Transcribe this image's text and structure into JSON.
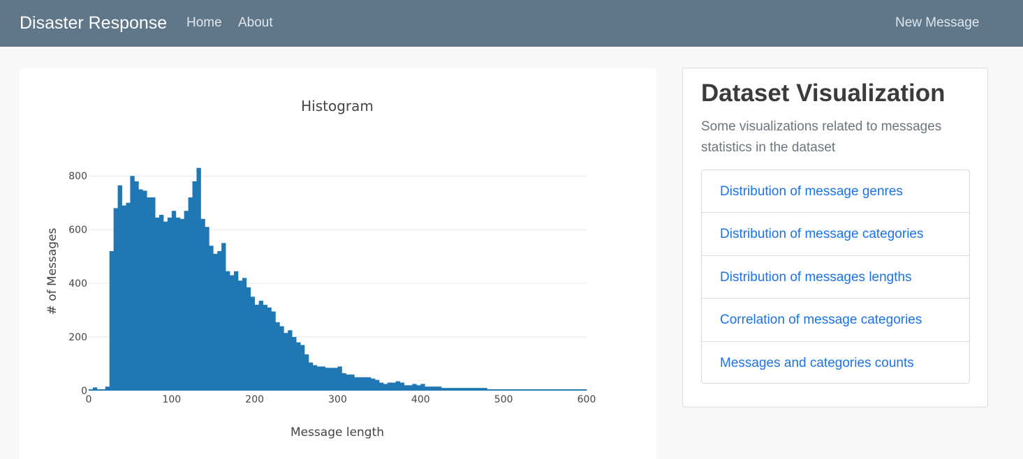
{
  "navbar": {
    "brand": "Disaster Response",
    "links": [
      "Home",
      "About"
    ],
    "right_link": "New Message"
  },
  "card": {
    "title": "Dataset Visualization",
    "subtitle": "Some visualizations related to messages statistics in the dataset",
    "items": [
      "Distribution of message genres",
      "Distribution of message categories",
      "Distribution of messages lengths",
      "Correlation of message categories",
      "Messages and categories counts"
    ]
  },
  "colors": {
    "navbar": "#607789",
    "bar": "#1f77b4",
    "link": "#1a73e8"
  },
  "chart_data": {
    "type": "bar",
    "title": "Histogram",
    "xlabel": "Message length",
    "ylabel": "# of Messages",
    "bin_width": 5,
    "xlim": [
      0,
      600
    ],
    "ylim": [
      0,
      850
    ],
    "yticks": [
      0,
      200,
      400,
      600,
      800
    ],
    "xticks": [
      0,
      100,
      200,
      300,
      400,
      500,
      600
    ],
    "grid": true,
    "bin_starts": [
      0,
      5,
      10,
      15,
      20,
      25,
      30,
      35,
      40,
      45,
      50,
      55,
      60,
      65,
      70,
      75,
      80,
      85,
      90,
      95,
      100,
      105,
      110,
      115,
      120,
      125,
      130,
      135,
      140,
      145,
      150,
      155,
      160,
      165,
      170,
      175,
      180,
      185,
      190,
      195,
      200,
      205,
      210,
      215,
      220,
      225,
      230,
      235,
      240,
      245,
      250,
      255,
      260,
      265,
      270,
      275,
      280,
      285,
      290,
      295,
      300,
      305,
      310,
      315,
      320,
      325,
      330,
      335,
      340,
      345,
      350,
      355,
      360,
      365,
      370,
      375,
      380,
      385,
      390,
      395,
      400,
      405,
      410,
      415,
      420,
      425,
      430,
      435,
      440,
      445,
      450,
      455,
      460,
      465,
      470,
      475,
      480,
      485,
      490,
      495,
      500,
      505,
      510,
      515,
      520,
      525,
      530,
      535,
      540,
      545,
      550,
      555,
      560,
      565,
      570,
      575,
      580,
      585,
      590,
      595
    ],
    "values": [
      5,
      12,
      5,
      5,
      15,
      520,
      680,
      765,
      690,
      700,
      800,
      780,
      750,
      745,
      720,
      720,
      645,
      655,
      630,
      645,
      670,
      645,
      640,
      670,
      720,
      780,
      830,
      640,
      610,
      540,
      510,
      520,
      550,
      445,
      430,
      445,
      410,
      420,
      385,
      350,
      320,
      335,
      320,
      310,
      295,
      255,
      240,
      215,
      225,
      200,
      180,
      170,
      135,
      105,
      95,
      90,
      90,
      85,
      85,
      85,
      90,
      65,
      60,
      60,
      50,
      50,
      50,
      50,
      45,
      40,
      30,
      25,
      30,
      30,
      35,
      30,
      20,
      20,
      25,
      20,
      25,
      15,
      15,
      15,
      15,
      10,
      10,
      10,
      10,
      10,
      10,
      10,
      10,
      10,
      10,
      10,
      5,
      5,
      5,
      5,
      5,
      5,
      5,
      5,
      5,
      5,
      5,
      5,
      5,
      5,
      5,
      5,
      5,
      5,
      5,
      5,
      5,
      5,
      5,
      5
    ]
  }
}
